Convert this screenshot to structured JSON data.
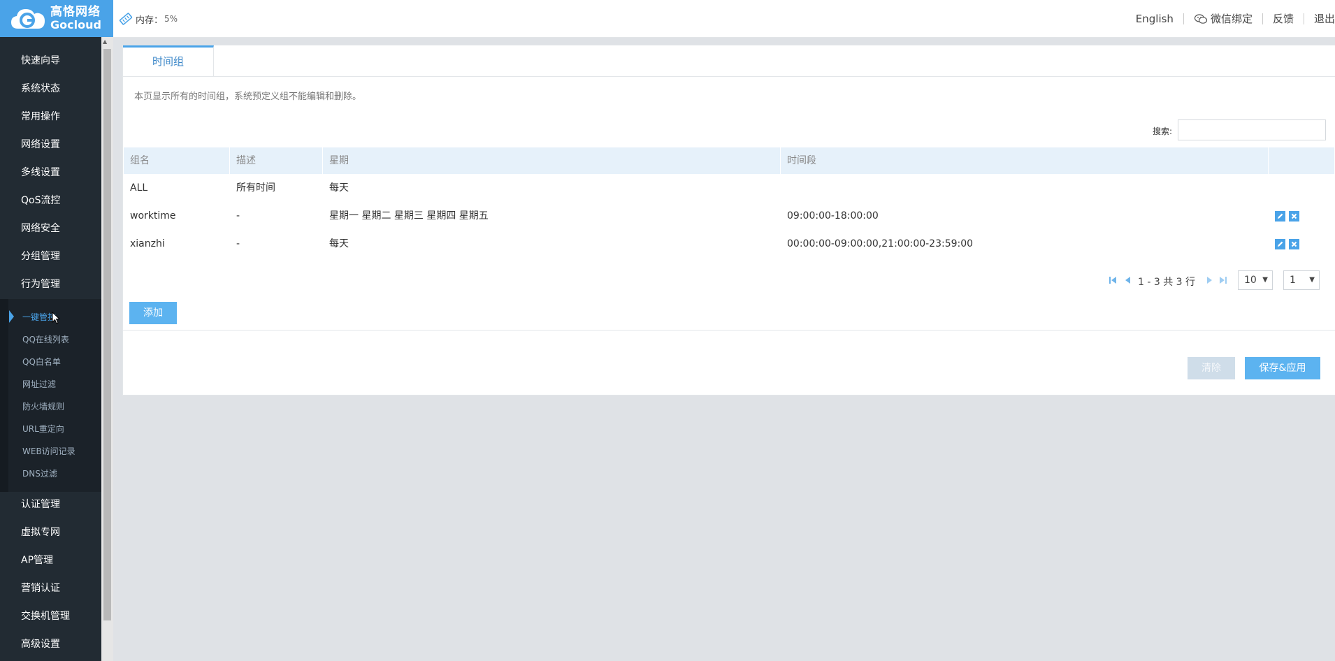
{
  "brand": {
    "cn": "高恪网络",
    "en": "Gocloud"
  },
  "topbar": {
    "memory_label": "内存：",
    "memory_value": "5%",
    "english": "English",
    "wechat": "微信绑定",
    "feedback": "反馈",
    "logout": "退出"
  },
  "sidebar": {
    "items_top": [
      "快速向导",
      "系统状态",
      "常用操作",
      "网络设置",
      "多线设置",
      "QoS流控",
      "网络安全",
      "分组管理",
      "行为管理"
    ],
    "sub_items": [
      "一键管控",
      "QQ在线列表",
      "QQ白名单",
      "网址过滤",
      "防火墙规则",
      "URL重定向",
      "WEB访问记录",
      "DNS过滤"
    ],
    "items_bottom": [
      "认证管理",
      "虚拟专网",
      "AP管理",
      "营销认证",
      "交换机管理",
      "高级设置"
    ]
  },
  "tab": {
    "label": "时间组"
  },
  "description": "本页显示所有的时间组，系统预定义组不能编辑和删除。",
  "search": {
    "label": "搜索:",
    "value": ""
  },
  "table": {
    "headers": [
      "组名",
      "描述",
      "星期",
      "时间段",
      ""
    ],
    "rows": [
      {
        "name": "ALL",
        "desc": "所有时间",
        "week": "每天",
        "period": "",
        "editable": false
      },
      {
        "name": "worktime",
        "desc": "-",
        "week": "星期一 星期二 星期三 星期四 星期五",
        "period": "09:00:00-18:00:00",
        "editable": true
      },
      {
        "name": "xianzhi",
        "desc": "-",
        "week": "每天",
        "period": "00:00:00-09:00:00,21:00:00-23:59:00",
        "editable": true
      }
    ]
  },
  "pager": {
    "summary": "1 - 3 共 3 行",
    "page_size": "10",
    "page": "1"
  },
  "buttons": {
    "add": "添加",
    "clear": "清除",
    "save": "保存&应用"
  },
  "colors": {
    "accent": "#4aa3e8",
    "sidebar": "#222b33",
    "header_row": "#e6f1fa"
  }
}
